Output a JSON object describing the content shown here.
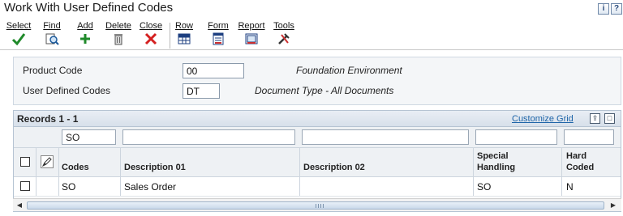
{
  "window": {
    "title": "Work With User Defined Codes",
    "help_label": "i",
    "menu_label": "?"
  },
  "toolbar": {
    "select": "Select",
    "find": "Find",
    "add": "Add",
    "delete": "Delete",
    "close": "Close",
    "row": "Row",
    "form": "Form",
    "report": "Report",
    "tools": "Tools"
  },
  "header": {
    "product_code_label": "Product Code",
    "product_code_value": "00",
    "product_code_desc": "Foundation Environment",
    "udc_label": "User Defined Codes",
    "udc_value": "DT",
    "udc_desc": "Document Type - All Documents"
  },
  "grid": {
    "records_label": "Records 1 - 1",
    "customize_label": "Customize Grid",
    "qbe": {
      "codes": "SO",
      "description01": "",
      "description02": "",
      "special_handling": "",
      "hard_coded": ""
    },
    "columns": {
      "codes": "Codes",
      "description01": "Description 01",
      "description02": "Description 02",
      "special_line1": "Special",
      "special_line2": "Handling",
      "hard_line1": "Hard",
      "hard_line2": "Coded"
    },
    "rows": [
      {
        "codes": "SO",
        "description01": "Sales Order",
        "description02": "",
        "special_handling": "SO",
        "hard_coded": "N"
      }
    ]
  }
}
